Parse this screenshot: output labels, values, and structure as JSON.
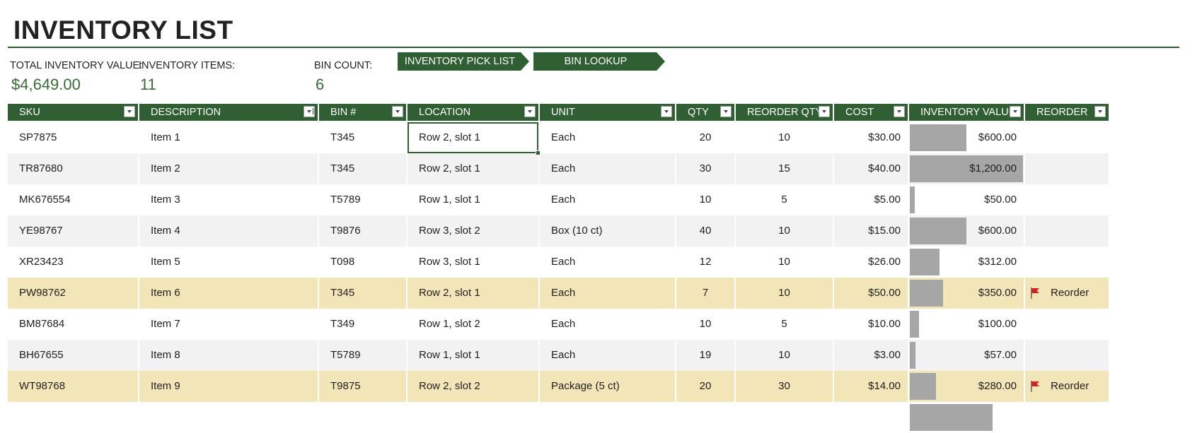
{
  "title": "INVENTORY LIST",
  "summary": {
    "total_value_label": "TOTAL INVENTORY VALUE:",
    "total_value": "$4,649.00",
    "items_label": "INVENTORY ITEMS:",
    "items_value": "11",
    "bin_count_label": "BIN COUNT:",
    "bin_count_value": "6"
  },
  "buttons": {
    "pick_list": "INVENTORY PICK LIST",
    "bin_lookup": "BIN LOOKUP"
  },
  "columns": [
    "SKU",
    "DESCRIPTION",
    "BIN #",
    "LOCATION",
    "UNIT",
    "QTY",
    "REORDER QTY",
    "COST",
    "INVENTORY VALUE",
    "REORDER"
  ],
  "rows": [
    {
      "sku": "SP7875",
      "description": "Item 1",
      "bin": "T345",
      "location": "Row 2, slot 1",
      "unit": "Each",
      "qty": "20",
      "reorder_qty": "10",
      "cost": "$30.00",
      "value": "$600.00",
      "value_num": 600,
      "reorder": ""
    },
    {
      "sku": "TR87680",
      "description": "Item 2",
      "bin": "T345",
      "location": "Row 2, slot 1",
      "unit": "Each",
      "qty": "30",
      "reorder_qty": "15",
      "cost": "$40.00",
      "value": "$1,200.00",
      "value_num": 1200,
      "reorder": ""
    },
    {
      "sku": "MK676554",
      "description": "Item 3",
      "bin": "T5789",
      "location": "Row 1, slot 1",
      "unit": "Each",
      "qty": "10",
      "reorder_qty": "5",
      "cost": "$5.00",
      "value": "$50.00",
      "value_num": 50,
      "reorder": ""
    },
    {
      "sku": "YE98767",
      "description": "Item 4",
      "bin": "T9876",
      "location": "Row 3, slot 2",
      "unit": "Box (10 ct)",
      "qty": "40",
      "reorder_qty": "10",
      "cost": "$15.00",
      "value": "$600.00",
      "value_num": 600,
      "reorder": ""
    },
    {
      "sku": "XR23423",
      "description": "Item 5",
      "bin": "T098",
      "location": "Row 3, slot 1",
      "unit": "Each",
      "qty": "12",
      "reorder_qty": "10",
      "cost": "$26.00",
      "value": "$312.00",
      "value_num": 312,
      "reorder": ""
    },
    {
      "sku": "PW98762",
      "description": "Item 6",
      "bin": "T345",
      "location": "Row 2, slot 1",
      "unit": "Each",
      "qty": "7",
      "reorder_qty": "10",
      "cost": "$50.00",
      "value": "$350.00",
      "value_num": 350,
      "reorder": "Reorder"
    },
    {
      "sku": "BM87684",
      "description": "Item 7",
      "bin": "T349",
      "location": "Row 1, slot 2",
      "unit": "Each",
      "qty": "10",
      "reorder_qty": "5",
      "cost": "$10.00",
      "value": "$100.00",
      "value_num": 100,
      "reorder": ""
    },
    {
      "sku": "BH67655",
      "description": "Item 8",
      "bin": "T5789",
      "location": "Row 1, slot 1",
      "unit": "Each",
      "qty": "19",
      "reorder_qty": "10",
      "cost": "$3.00",
      "value": "$57.00",
      "value_num": 57,
      "reorder": ""
    },
    {
      "sku": "WT98768",
      "description": "Item 9",
      "bin": "T9875",
      "location": "Row 2, slot 2",
      "unit": "Package (5 ct)",
      "qty": "20",
      "reorder_qty": "30",
      "cost": "$14.00",
      "value": "$280.00",
      "value_num": 280,
      "reorder": "Reorder"
    }
  ],
  "partial_row": {
    "value_num": 880
  },
  "value_max": 1200,
  "selected_cell": {
    "row": 0,
    "column": "location"
  },
  "colors": {
    "header_green": "#2f5f33",
    "accent_value": "#3a6b37",
    "band_grey": "#f2f2f2",
    "reorder_highlight": "#f2e5b8",
    "databar": "#a6a6a6",
    "flag_red": "#d42020"
  },
  "icons": {
    "filter": "filter-dropdown-icon",
    "reorder": "red-flag-icon"
  }
}
